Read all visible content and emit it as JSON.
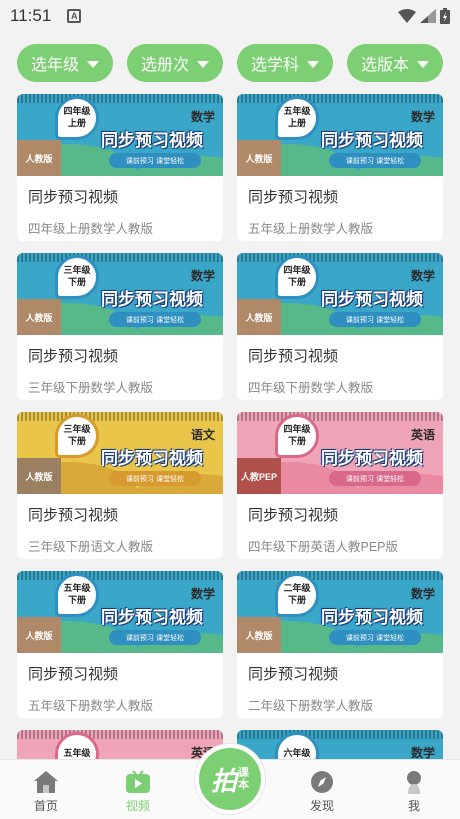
{
  "status_bar": {
    "time": "11:51",
    "notification_icon": "A"
  },
  "filters": [
    {
      "label": "选年级"
    },
    {
      "label": "选册次"
    },
    {
      "label": "选学科"
    },
    {
      "label": "选版本"
    }
  ],
  "colors": {
    "accent": "#7ccf72"
  },
  "cards": [
    {
      "grade": "四年级",
      "term": "上册",
      "subject": "数学",
      "edition": "人教版",
      "banner_title": "同步预习视频",
      "banner_slogan": "课前预习 课堂轻松",
      "title": "同步预习视频",
      "subtitle": "四年级上册数学人教版",
      "theme": {
        "bg": "#3aa6c8",
        "wave": "#57b98a",
        "side": "#b08a68",
        "pill": "#2f8fc0"
      }
    },
    {
      "grade": "五年级",
      "term": "上册",
      "subject": "数学",
      "edition": "人教版",
      "banner_title": "同步预习视频",
      "banner_slogan": "课前预习 课堂轻松",
      "title": "同步预习视频",
      "subtitle": "五年级上册数学人教版",
      "theme": {
        "bg": "#3aa6c8",
        "wave": "#57b98a",
        "side": "#b08a68",
        "pill": "#2f8fc0"
      }
    },
    {
      "grade": "三年级",
      "term": "下册",
      "subject": "数学",
      "edition": "人教版",
      "banner_title": "同步预习视频",
      "banner_slogan": "课前预习 课堂轻松",
      "title": "同步预习视频",
      "subtitle": "三年级下册数学人教版",
      "theme": {
        "bg": "#3aa6c8",
        "wave": "#57b98a",
        "side": "#b08a68",
        "pill": "#2f8fc0"
      }
    },
    {
      "grade": "四年级",
      "term": "下册",
      "subject": "数学",
      "edition": "人教版",
      "banner_title": "同步预习视频",
      "banner_slogan": "课前预习 课堂轻松",
      "title": "同步预习视频",
      "subtitle": "四年级下册数学人教版",
      "theme": {
        "bg": "#3aa6c8",
        "wave": "#57b98a",
        "side": "#b08a68",
        "pill": "#2f8fc0"
      }
    },
    {
      "grade": "三年级",
      "term": "下册",
      "subject": "语文",
      "edition": "人教版",
      "banner_title": "同步预习视频",
      "banner_slogan": "课前预习 课堂轻松",
      "title": "同步预习视频",
      "subtitle": "三年级下册语文人教版",
      "theme": {
        "bg": "#e9c64a",
        "wave": "#d9a93a",
        "side": "#9a8060",
        "pill": "#d69a2e"
      }
    },
    {
      "grade": "四年级",
      "term": "下册",
      "subject": "英语",
      "edition": "人教PEP",
      "banner_title": "同步预习视频",
      "banner_slogan": "课前预习 课堂轻松",
      "title": "同步预习视频",
      "subtitle": "四年级下册英语人教PEP版",
      "theme": {
        "bg": "#f0a4b8",
        "wave": "#e98aa2",
        "side": "#b0504a",
        "pill": "#d9688a"
      }
    },
    {
      "grade": "五年级",
      "term": "下册",
      "subject": "数学",
      "edition": "人教版",
      "banner_title": "同步预习视频",
      "banner_slogan": "课前预习 课堂轻松",
      "title": "同步预习视频",
      "subtitle": "五年级下册数学人教版",
      "theme": {
        "bg": "#3aa6c8",
        "wave": "#57b98a",
        "side": "#b08a68",
        "pill": "#2f8fc0"
      }
    },
    {
      "grade": "二年级",
      "term": "下册",
      "subject": "数学",
      "edition": "人教版",
      "banner_title": "同步预习视频",
      "banner_slogan": "课前预习 课堂轻松",
      "title": "同步预习视频",
      "subtitle": "二年级下册数学人教版",
      "theme": {
        "bg": "#3aa6c8",
        "wave": "#57b98a",
        "side": "#b08a68",
        "pill": "#2f8fc0"
      }
    }
  ],
  "partial_cards": [
    {
      "grade": "五年级",
      "subject": "英语",
      "theme": {
        "bg": "#f0a4b8",
        "wave": "#e98aa2",
        "side": "#b0504a",
        "pill": "#d9688a"
      }
    },
    {
      "grade": "六年级",
      "subject": "数学",
      "theme": {
        "bg": "#3aa6c8",
        "wave": "#57b98a",
        "side": "#b08a68",
        "pill": "#2f8fc0"
      }
    }
  ],
  "tabbar": {
    "tabs": [
      {
        "label": "首页",
        "icon": "home-icon"
      },
      {
        "label": "视频",
        "icon": "video-icon",
        "active": true
      },
      {
        "label": "",
        "icon": "center-logo"
      },
      {
        "label": "发现",
        "icon": "compass-icon"
      },
      {
        "label": "我",
        "icon": "person-icon"
      }
    ],
    "center_big": "拍",
    "center_small_1": "课",
    "center_small_2": "本"
  }
}
